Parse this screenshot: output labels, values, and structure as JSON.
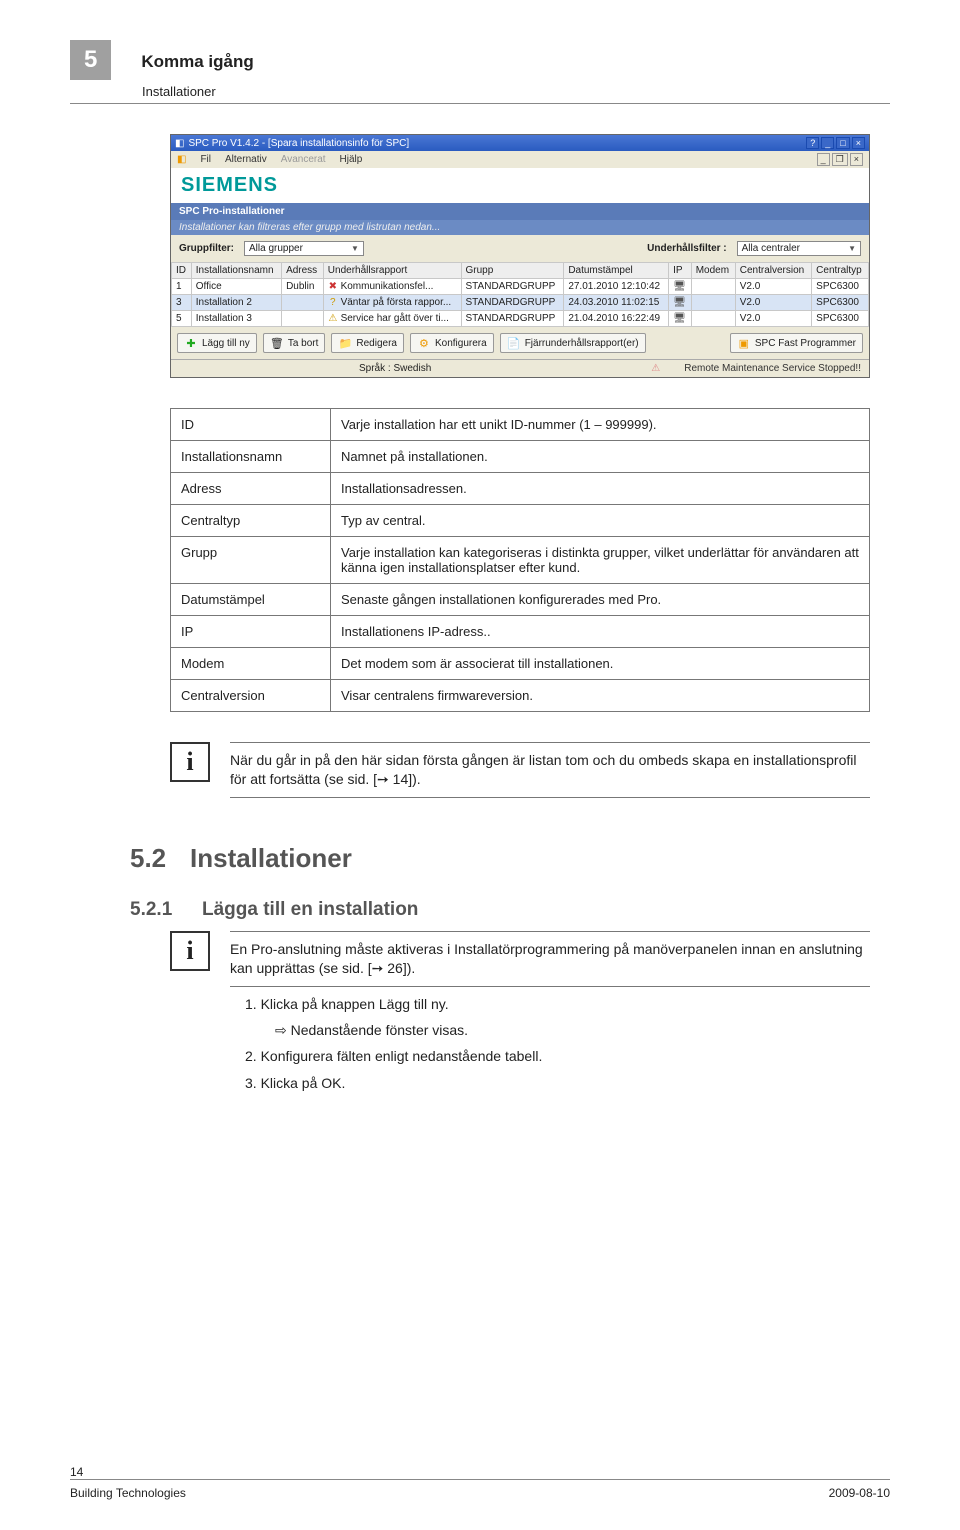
{
  "page_header": {
    "num": "5",
    "title": "Komma igång",
    "subtitle": "Installationer"
  },
  "screenshot": {
    "titlebar": "SPC Pro V1.4.2 - [Spara installationsinfo för SPC]",
    "menu": {
      "fil": "Fil",
      "alternativ": "Alternativ",
      "avancerat": "Avancerat",
      "hjalp": "Hjälp"
    },
    "brand": "SIEMENS",
    "panel_title": "SPC Pro-installationer",
    "panel_sub": "Installationer kan filtreras efter grupp med listrutan nedan...",
    "filter": {
      "group_label": "Gruppfilter:",
      "group_value": "Alla grupper",
      "maint_label": "Underhållsfilter :",
      "maint_value": "Alla centraler"
    },
    "cols": [
      "ID",
      "Installationsnamn",
      "Adress",
      "Underhållsrapport",
      "Grupp",
      "Datumstämpel",
      "IP",
      "Modem",
      "Centralversion",
      "Centraltyp"
    ],
    "rows": [
      {
        "id": "1",
        "name": "Office",
        "addr": "Dublin",
        "rpt": "Kommunikationsfel...",
        "grp": "STANDARDGRUPP",
        "ts": "27.01.2010 12:10:42",
        "ver": "V2.0",
        "ctype": "SPC6300",
        "rpt_color": "#c33"
      },
      {
        "id": "3",
        "name": "Installation 2",
        "addr": "",
        "rpt": "Väntar på första rappor...",
        "grp": "STANDARDGRUPP",
        "ts": "24.03.2010 11:02:15",
        "ver": "V2.0",
        "ctype": "SPC6300",
        "rpt_color": "#c90"
      },
      {
        "id": "5",
        "name": "Installation 3",
        "addr": "",
        "rpt": "Service har gått över ti...",
        "grp": "STANDARDGRUPP",
        "ts": "21.04.2010 16:22:49",
        "ver": "V2.0",
        "ctype": "SPC6300",
        "rpt_color": "#c90"
      }
    ],
    "buttons": {
      "add": "Lägg till ny",
      "del": "Ta bort",
      "edit": "Redigera",
      "cfg": "Konfigurera",
      "rpt": "Fjärrunderhållsrapport(er)",
      "fast": "SPC Fast Programmer"
    },
    "statusbar": {
      "lang": "Språk : Swedish",
      "warn": "Remote Maintenance Service Stopped!!"
    }
  },
  "defs": [
    {
      "k": "ID",
      "v": "Varje installation har ett unikt ID-nummer (1 – 999999)."
    },
    {
      "k": "Installationsnamn",
      "v": "Namnet på installationen."
    },
    {
      "k": "Adress",
      "v": "Installationsadressen."
    },
    {
      "k": "Centraltyp",
      "v": "Typ av central."
    },
    {
      "k": "Grupp",
      "v": "Varje installation kan kategoriseras i distinkta grupper, vilket underlättar för användaren att känna igen installationsplatser efter kund."
    },
    {
      "k": "Datumstämpel",
      "v": "Senaste gången installationen konfigurerades med  Pro."
    },
    {
      "k": "IP",
      "v": "Installationens IP-adress.."
    },
    {
      "k": "Modem",
      "v": "Det modem som är associerat till installationen."
    },
    {
      "k": "Centralversion",
      "v": "Visar centralens firmwareversion."
    }
  ],
  "note1": "När du går in på den här sidan första gången är listan tom och du ombeds skapa en installationsprofil för att fortsätta (se sid. [➙ 14]).",
  "h2": {
    "num": "5.2",
    "text": "Installationer"
  },
  "h3": {
    "num": "5.2.1",
    "text": "Lägga till en installation"
  },
  "note2": "En  Pro-anslutning måste aktiveras i Installatörprogrammering på manöverpanelen innan en anslutning kan upprättas (se sid. [➙ 26]).",
  "steps": {
    "s1": "1.   Klicka på knappen Lägg till ny.",
    "r1": "Nedanstående fönster visas.",
    "s2": "2.   Konfigurera fälten enligt nedanstående tabell.",
    "s3": "3.   Klicka på OK."
  },
  "footer": {
    "pagenum": "14",
    "org": "Building Technologies",
    "date": "2009-08-10"
  }
}
